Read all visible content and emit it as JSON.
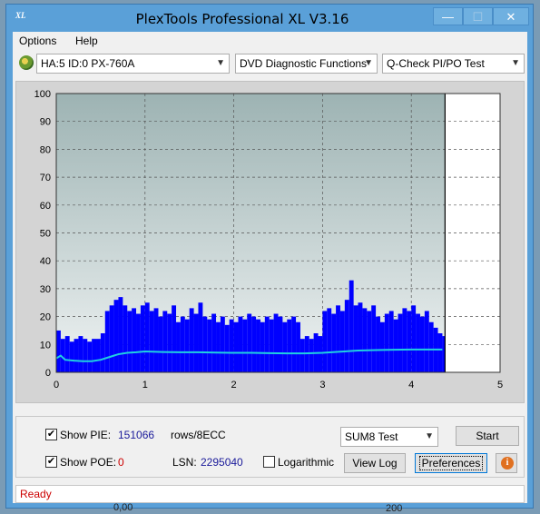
{
  "window": {
    "title": "PlexTools Professional XL V3.16",
    "icon_label": "XL",
    "controls": {
      "minimize": "—",
      "maximize": "☐",
      "close": "✕"
    }
  },
  "menu": [
    {
      "label": "Options",
      "hotkey": "O"
    },
    {
      "label": "Help",
      "hotkey": "H"
    }
  ],
  "toolbar": {
    "drive": "HA:5 ID:0  PX-760A",
    "function": "DVD Diagnostic Functions",
    "test": "Q-Check PI/PO Test"
  },
  "chart_data": {
    "type": "bar",
    "title": "",
    "xlabel": "",
    "ylabel": "",
    "xlim": [
      0,
      5
    ],
    "ylim": [
      0,
      100
    ],
    "x_ticks": [
      0,
      1,
      2,
      3,
      4,
      5
    ],
    "y_ticks": [
      0,
      10,
      20,
      30,
      40,
      50,
      60,
      70,
      80,
      90,
      100
    ],
    "grid": true,
    "end_marker_x": 4.38,
    "series": [
      {
        "type": "bar",
        "color": "#0000ff",
        "x": [
          0.0,
          0.05,
          0.1,
          0.15,
          0.2,
          0.25,
          0.3,
          0.35,
          0.4,
          0.45,
          0.5,
          0.55,
          0.6,
          0.65,
          0.7,
          0.75,
          0.8,
          0.85,
          0.9,
          0.95,
          1.0,
          1.05,
          1.1,
          1.15,
          1.2,
          1.25,
          1.3,
          1.35,
          1.4,
          1.45,
          1.5,
          1.55,
          1.6,
          1.65,
          1.7,
          1.75,
          1.8,
          1.85,
          1.9,
          1.95,
          2.0,
          2.05,
          2.1,
          2.15,
          2.2,
          2.25,
          2.3,
          2.35,
          2.4,
          2.45,
          2.5,
          2.55,
          2.6,
          2.65,
          2.7,
          2.75,
          2.8,
          2.85,
          2.9,
          2.95,
          3.0,
          3.05,
          3.1,
          3.15,
          3.2,
          3.25,
          3.3,
          3.35,
          3.4,
          3.45,
          3.5,
          3.55,
          3.6,
          3.65,
          3.7,
          3.75,
          3.8,
          3.85,
          3.9,
          3.95,
          4.0,
          4.05,
          4.1,
          4.15,
          4.2,
          4.25,
          4.3,
          4.35
        ],
        "values": [
          15,
          12,
          13,
          11,
          12,
          13,
          12,
          11,
          12,
          12,
          14,
          22,
          24,
          26,
          27,
          24,
          22,
          23,
          21,
          24,
          25,
          22,
          23,
          20,
          22,
          21,
          24,
          18,
          20,
          19,
          23,
          21,
          25,
          20,
          19,
          21,
          18,
          20,
          17,
          19,
          18,
          20,
          19,
          21,
          20,
          19,
          18,
          20,
          19,
          21,
          20,
          18,
          19,
          20,
          18,
          12,
          13,
          12,
          14,
          13,
          22,
          23,
          21,
          24,
          22,
          26,
          33,
          24,
          25,
          23,
          22,
          24,
          20,
          18,
          21,
          22,
          19,
          21,
          23,
          22,
          24,
          21,
          20,
          22,
          18,
          16,
          14,
          13
        ]
      },
      {
        "type": "line",
        "color": "#20d0e0",
        "x": [
          0.0,
          0.05,
          0.1,
          0.2,
          0.3,
          0.4,
          0.5,
          0.6,
          0.7,
          0.8,
          0.9,
          1.0,
          1.2,
          1.4,
          1.6,
          1.8,
          2.0,
          2.2,
          2.4,
          2.6,
          2.8,
          3.0,
          3.2,
          3.4,
          3.6,
          3.8,
          4.0,
          4.2,
          4.35
        ],
        "values": [
          5,
          6,
          4.5,
          4.2,
          4.0,
          4.0,
          4.5,
          5.5,
          6.5,
          7.0,
          7.2,
          7.5,
          7.3,
          7.2,
          7.2,
          7.1,
          7.0,
          7.0,
          6.9,
          6.8,
          6.8,
          7.0,
          7.4,
          7.8,
          8.0,
          8.1,
          8.2,
          8.2,
          8.2
        ]
      }
    ]
  },
  "panel": {
    "show_pie": {
      "label": "Show PIE:",
      "checked": "✔",
      "value": "151066",
      "unit": "rows/8ECC"
    },
    "show_poe": {
      "label": "Show POE:",
      "checked": "✔",
      "value": "0"
    },
    "lsn": {
      "label": "LSN:",
      "value": "2295040"
    },
    "logarithmic": {
      "label": "Logarithmic",
      "checked": ""
    },
    "sum_test": "SUM8 Test",
    "start_button": "Start",
    "view_log_button": "View Log",
    "preferences_button": "Preferences",
    "info_icon": "info-icon"
  },
  "status": {
    "text": "Ready"
  },
  "background": {
    "text_left": "0,00",
    "text_right": "200"
  }
}
